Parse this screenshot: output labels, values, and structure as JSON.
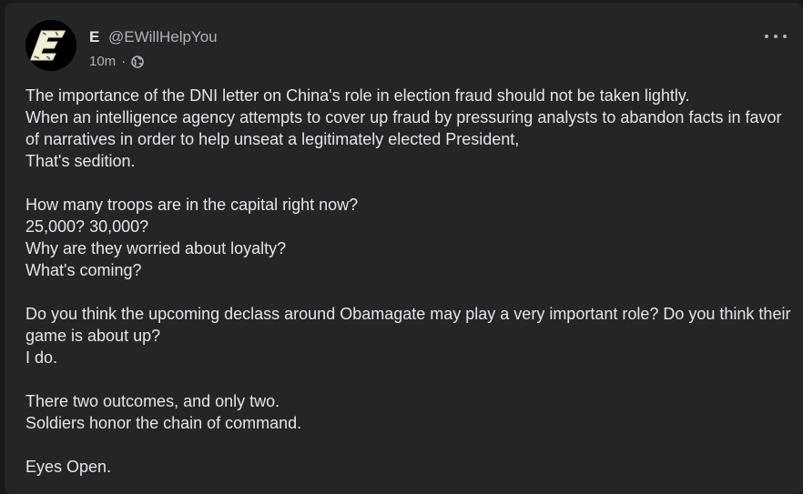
{
  "post": {
    "author": {
      "name": "E",
      "handle": "@EWillHelpYou",
      "avatar_icon": "e-logo-icon"
    },
    "meta": {
      "time": "10m",
      "separator": "·",
      "audience_icon": "globe-icon"
    },
    "menu_icon": "more-options-icon",
    "paragraphs": [
      "The importance of the DNI letter on China's role in election fraud should not be taken lightly.\nWhen an intelligence agency attempts to cover up fraud by pressuring analysts to abandon facts in favor of narratives in order to help unseat a legitimately elected President,\nThat's sedition.",
      "How many troops are in the capital right now?\n25,000? 30,000?\nWhy are they worried about loyalty?\nWhat's coming?",
      "Do you think the upcoming declass around Obamagate may play a very important role? Do you think their game is about up?\nI do.",
      "There two outcomes, and only two.\nSoldiers honor the chain of command.",
      "Eyes Open."
    ]
  },
  "colors": {
    "page_background": "#18191a",
    "card_background": "#242526",
    "primary_text": "#e4e6eb",
    "secondary_text": "#b0b3b8",
    "avatar_background": "#000000",
    "avatar_letter": "#f2efd8"
  }
}
